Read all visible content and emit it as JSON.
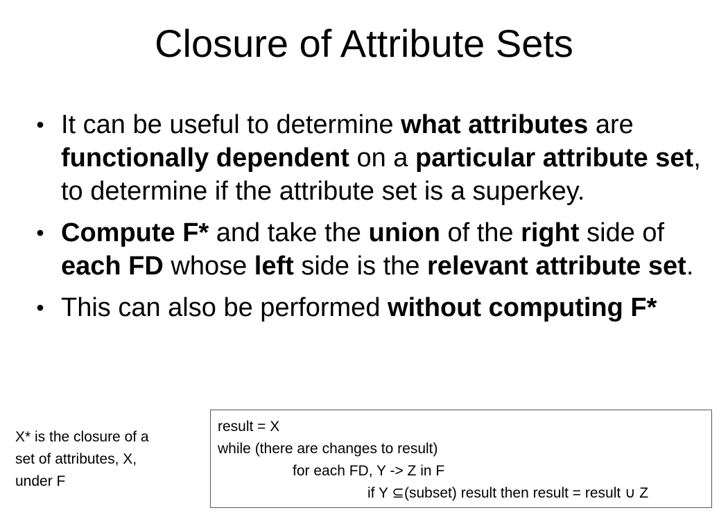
{
  "slide": {
    "title": "Closure of Attribute Sets"
  },
  "bullets": [
    {
      "segments": [
        {
          "text": "It can be useful to determine ",
          "bold": false
        },
        {
          "text": "what attributes",
          "bold": true
        },
        {
          "text": " are ",
          "bold": false
        },
        {
          "text": "functionally dependent",
          "bold": true
        },
        {
          "text": " on a ",
          "bold": false
        },
        {
          "text": "particular attribute set",
          "bold": true
        },
        {
          "text": ", to determine if the attribute set is a superkey.",
          "bold": false
        }
      ]
    },
    {
      "segments": [
        {
          "text": "Compute F*",
          "bold": true
        },
        {
          "text": " and take the ",
          "bold": false
        },
        {
          "text": "union",
          "bold": true
        },
        {
          "text": " of the ",
          "bold": false
        },
        {
          "text": "right",
          "bold": true
        },
        {
          "text": " side of ",
          "bold": false
        },
        {
          "text": "each FD",
          "bold": true
        },
        {
          "text": " whose ",
          "bold": false
        },
        {
          "text": "left",
          "bold": true
        },
        {
          "text": " side is the ",
          "bold": false
        },
        {
          "text": "relevant attribute set",
          "bold": true
        },
        {
          "text": ".",
          "bold": false
        }
      ]
    },
    {
      "segments": [
        {
          "text": "This can also be performed ",
          "bold": false
        },
        {
          "text": "without computing F*",
          "bold": true
        }
      ]
    }
  ],
  "side_note": {
    "lines": [
      "X* is the closure  of a",
      "set of attributes, X,",
      "under F"
    ]
  },
  "algorithm": {
    "lines": [
      "result = X",
      "while (there are changes to result)",
      "for each FD, Y -> Z in F",
      "if Y ⊆(subset) result then result = result ∪ Z"
    ]
  }
}
